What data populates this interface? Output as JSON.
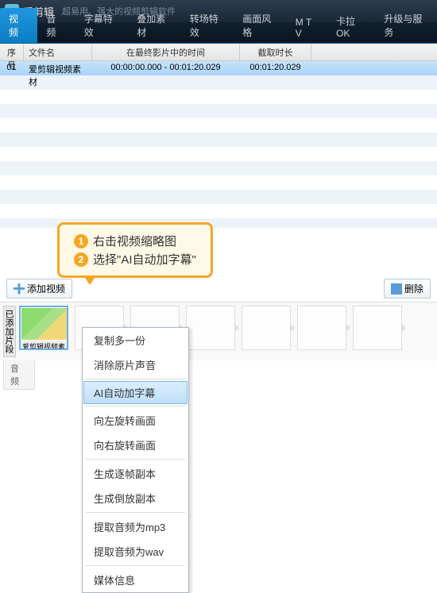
{
  "header": {
    "app_name": "爱剪辑",
    "tagline": "超易用、强大的视频剪辑软件"
  },
  "tabs": [
    "视 频",
    "音 频",
    "字幕特效",
    "叠加素材",
    "转场特效",
    "画面风格",
    "M T V",
    "卡拉OK",
    "升级与服务"
  ],
  "active_tab": 0,
  "table": {
    "headers": {
      "num": "序号",
      "name": "文件名",
      "time": "在最终影片中的时间",
      "dur": "截取时长"
    },
    "rows": [
      {
        "num": "01",
        "name": "爱剪辑视频素材",
        "time": "00:00:00.000 - 00:01:20.029",
        "dur": "00:01:20.029"
      }
    ]
  },
  "callout": {
    "line1": "右击视频缩略图",
    "line2": "选择\"AI自动加字幕\""
  },
  "toolbar": {
    "add": "添加视频",
    "delete": "删除"
  },
  "strip": {
    "side_label": "已添加片段",
    "thumb_label": "爱剪辑视频素材",
    "bottom_tab": "音 频"
  },
  "context_menu": {
    "items": [
      {
        "label": "复制多一份",
        "sep": false
      },
      {
        "label": "消除原片声音",
        "sep": true
      },
      {
        "label": "AI自动加字幕",
        "sep": true,
        "highlight": true
      },
      {
        "label": "向左旋转画面",
        "sep": false
      },
      {
        "label": "向右旋转画面",
        "sep": true
      },
      {
        "label": "生成逐帧副本",
        "sep": false
      },
      {
        "label": "生成倒放副本",
        "sep": true
      },
      {
        "label": "提取音频为mp3",
        "sep": false
      },
      {
        "label": "提取音频为wav",
        "sep": true
      },
      {
        "label": "媒体信息",
        "sep": false
      }
    ]
  }
}
